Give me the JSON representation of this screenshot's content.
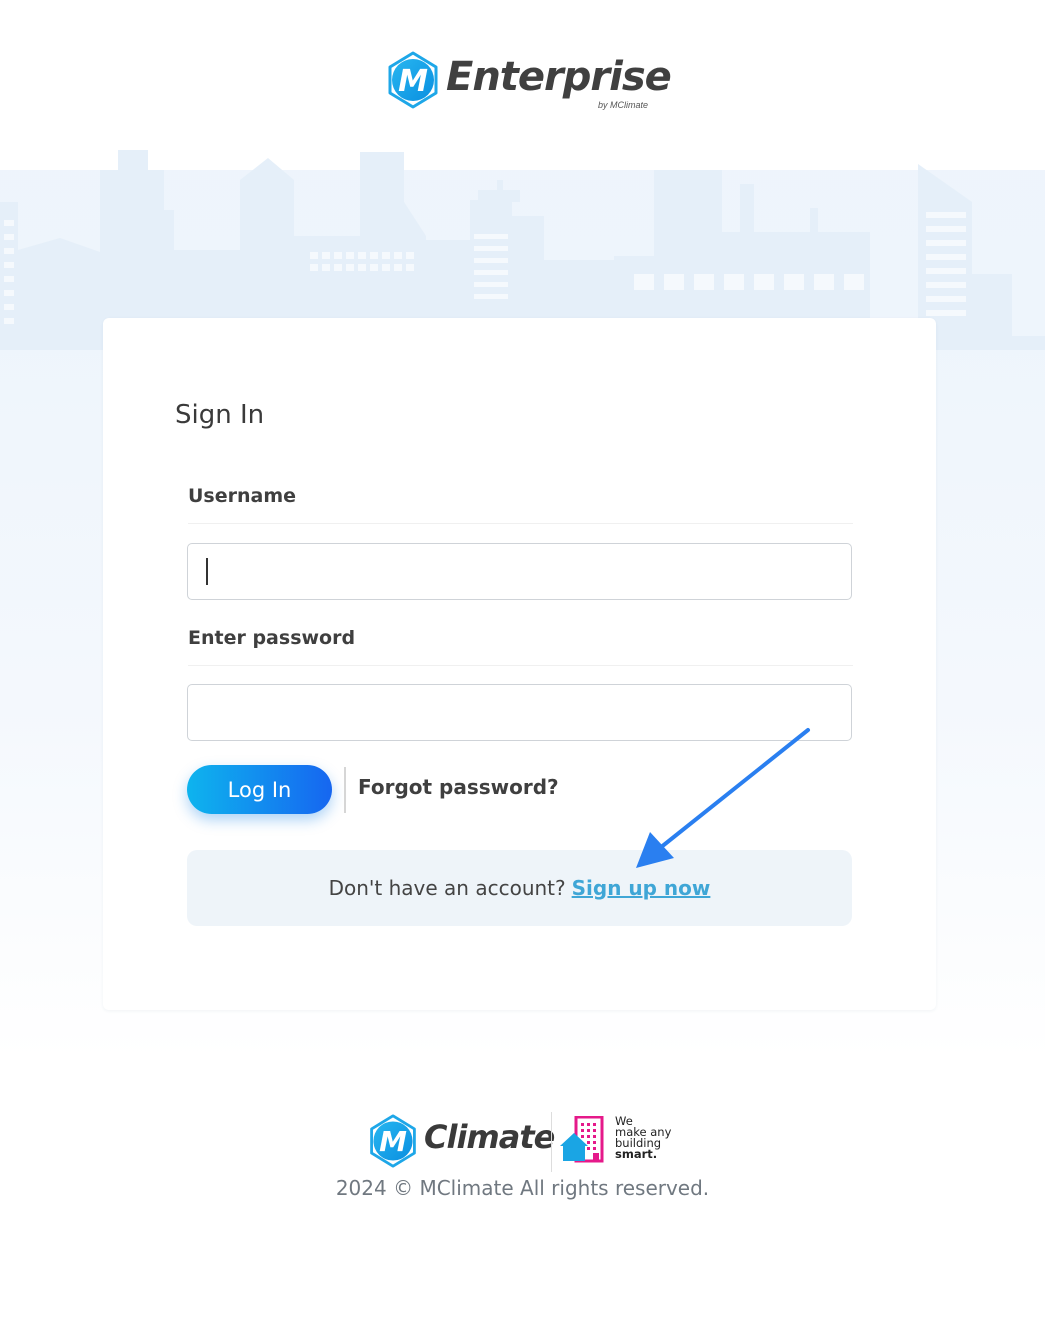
{
  "brand": {
    "header_name": "Enterprise",
    "header_byline": "by MClimate",
    "footer_name": "Climate",
    "tagline": [
      "We",
      "make any",
      "building",
      "smart."
    ]
  },
  "form": {
    "title": "Sign In",
    "username_label": "Username",
    "username_value": "",
    "password_label": "Enter password",
    "password_value": "",
    "login_button": "Log In",
    "forgot_link": "Forgot password?",
    "signup_prompt": "Don't have an account?",
    "signup_link": "Sign up now"
  },
  "footer": {
    "copyright": "2024 © MClimate All rights reserved."
  },
  "colors": {
    "accent_start": "#0eb4ee",
    "accent_end": "#1666f0",
    "link": "#3fa6d6",
    "annotation_arrow": "#2a7ff0",
    "tag_pink": "#e5198a"
  }
}
